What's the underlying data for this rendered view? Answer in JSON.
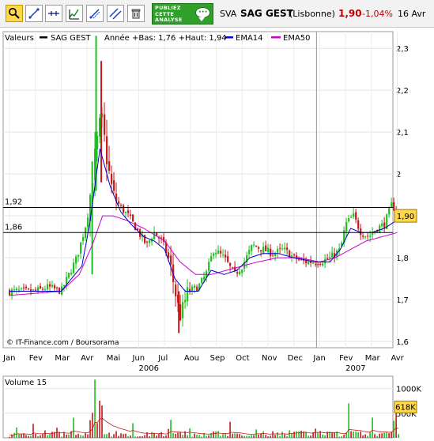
{
  "toolbar": {
    "tools": [
      {
        "name": "zoom-tool",
        "active": true
      },
      {
        "name": "line-tool",
        "active": false
      },
      {
        "name": "horizontal-line-tool",
        "active": false
      },
      {
        "name": "trend-channel-tool",
        "active": false
      },
      {
        "name": "fibonacci-tool",
        "active": false
      },
      {
        "name": "parallel-lines-tool",
        "active": false
      },
      {
        "name": "trash-tool",
        "active": false
      }
    ],
    "promo_text": "PUBLIEZ CETTE ANALYSE",
    "market": "SVA",
    "name": "SAG GEST",
    "exchange": "(Lisbonne)",
    "price": "1,90",
    "change": "-1,04%",
    "date": "16 Avr",
    "colors": {
      "price": "#c00000",
      "change": "#c00000",
      "promo": "#2fa02a"
    }
  },
  "chart_data": [
    {
      "type": "candlestick",
      "legend": [
        {
          "label": "Valeurs",
          "color": ""
        },
        {
          "label": "SAG GEST",
          "color": "#000000"
        },
        {
          "label": "Année +Bas: 1,76 +Haut: 1,94",
          "color": ""
        },
        {
          "label": "EMA14",
          "color": "#0000cc"
        },
        {
          "label": "EMA50",
          "color": "#cc00cc"
        }
      ],
      "y_ticks": [
        "2,3",
        "2,2",
        "2,1",
        "2",
        "1,9",
        "1,8",
        "1,7",
        "1,6"
      ],
      "y_range": [
        1.585,
        2.34
      ],
      "x_month_labels": [
        "Jan",
        "Fev",
        "Mar",
        "Avr",
        "Mai",
        "Jun",
        "Jul",
        "Aou",
        "Sep",
        "Oct",
        "Nov",
        "Dec",
        "Jan",
        "Fev",
        "Mar",
        "Avr"
      ],
      "x_year_labels": [
        {
          "label": "2006",
          "month_index": 5
        },
        {
          "label": "2007",
          "month_index": 13
        }
      ],
      "reference_lines": [
        {
          "value": 1.92,
          "label": "1,92"
        },
        {
          "value": 1.86,
          "label": "1,86"
        }
      ],
      "last_price_tag": {
        "value": 1.9,
        "label": "1,90"
      },
      "credit": "© IT-Finance.com / Boursorama",
      "close_keypoints": [
        [
          0,
          1.72
        ],
        [
          1,
          1.72
        ],
        [
          1.5,
          1.73
        ],
        [
          2,
          1.72
        ],
        [
          2.6,
          1.8
        ],
        [
          3,
          1.89
        ],
        [
          3.3,
          2.04
        ],
        [
          3.55,
          2.14
        ],
        [
          3.8,
          2.02
        ],
        [
          4.0,
          1.95
        ],
        [
          4.3,
          1.92
        ],
        [
          4.6,
          1.9
        ],
        [
          5,
          1.86
        ],
        [
          5.3,
          1.83
        ],
        [
          5.6,
          1.86
        ],
        [
          5.9,
          1.84
        ],
        [
          6.2,
          1.79
        ],
        [
          6.4,
          1.72
        ],
        [
          6.6,
          1.66
        ],
        [
          6.9,
          1.72
        ],
        [
          7.3,
          1.73
        ],
        [
          7.6,
          1.76
        ],
        [
          7.9,
          1.82
        ],
        [
          8.3,
          1.8
        ],
        [
          8.7,
          1.76
        ],
        [
          9,
          1.78
        ],
        [
          9.4,
          1.83
        ],
        [
          9.8,
          1.82
        ],
        [
          10.2,
          1.81
        ],
        [
          10.6,
          1.82
        ],
        [
          11,
          1.8
        ],
        [
          11.4,
          1.79
        ],
        [
          11.8,
          1.79
        ],
        [
          12,
          1.79
        ],
        [
          12.4,
          1.8
        ],
        [
          12.8,
          1.82
        ],
        [
          13.0,
          1.88
        ],
        [
          13.3,
          1.9
        ],
        [
          13.6,
          1.86
        ],
        [
          13.9,
          1.85
        ],
        [
          14.2,
          1.87
        ],
        [
          14.5,
          1.88
        ],
        [
          14.8,
          1.93
        ],
        [
          15.0,
          1.9
        ]
      ],
      "ema14_keypoints": [
        [
          0,
          1.72
        ],
        [
          2,
          1.72
        ],
        [
          2.8,
          1.78
        ],
        [
          3.1,
          1.88
        ],
        [
          3.5,
          2.06
        ],
        [
          3.9,
          1.97
        ],
        [
          4.3,
          1.91
        ],
        [
          4.7,
          1.88
        ],
        [
          5.2,
          1.85
        ],
        [
          5.6,
          1.84
        ],
        [
          6.0,
          1.82
        ],
        [
          6.4,
          1.75
        ],
        [
          6.8,
          1.72
        ],
        [
          7.3,
          1.72
        ],
        [
          7.8,
          1.77
        ],
        [
          8.3,
          1.76
        ],
        [
          8.8,
          1.77
        ],
        [
          9.3,
          1.8
        ],
        [
          9.8,
          1.81
        ],
        [
          10.4,
          1.81
        ],
        [
          11,
          1.8
        ],
        [
          11.8,
          1.79
        ],
        [
          12.4,
          1.79
        ],
        [
          12.8,
          1.82
        ],
        [
          13.2,
          1.87
        ],
        [
          13.6,
          1.86
        ],
        [
          14.0,
          1.86
        ],
        [
          14.5,
          1.87
        ],
        [
          15.0,
          1.89
        ]
      ],
      "ema50_keypoints": [
        [
          0,
          1.71
        ],
        [
          2,
          1.72
        ],
        [
          2.7,
          1.76
        ],
        [
          3.2,
          1.83
        ],
        [
          3.6,
          1.9
        ],
        [
          4.0,
          1.9
        ],
        [
          4.5,
          1.89
        ],
        [
          5.2,
          1.87
        ],
        [
          6.0,
          1.84
        ],
        [
          6.6,
          1.79
        ],
        [
          7.2,
          1.76
        ],
        [
          7.8,
          1.76
        ],
        [
          8.4,
          1.77
        ],
        [
          9.0,
          1.78
        ],
        [
          9.6,
          1.79
        ],
        [
          10.4,
          1.8
        ],
        [
          11.2,
          1.8
        ],
        [
          12.0,
          1.79
        ],
        [
          12.6,
          1.8
        ],
        [
          13.2,
          1.82
        ],
        [
          13.8,
          1.84
        ],
        [
          14.4,
          1.85
        ],
        [
          15.0,
          1.86
        ]
      ]
    },
    {
      "type": "bar",
      "title": "Volume 15",
      "y_ticks": [
        "1000K",
        "500K"
      ],
      "y_range": [
        0,
        1250
      ],
      "last_volume_tag": {
        "value": 618,
        "label": "618K"
      }
    }
  ]
}
